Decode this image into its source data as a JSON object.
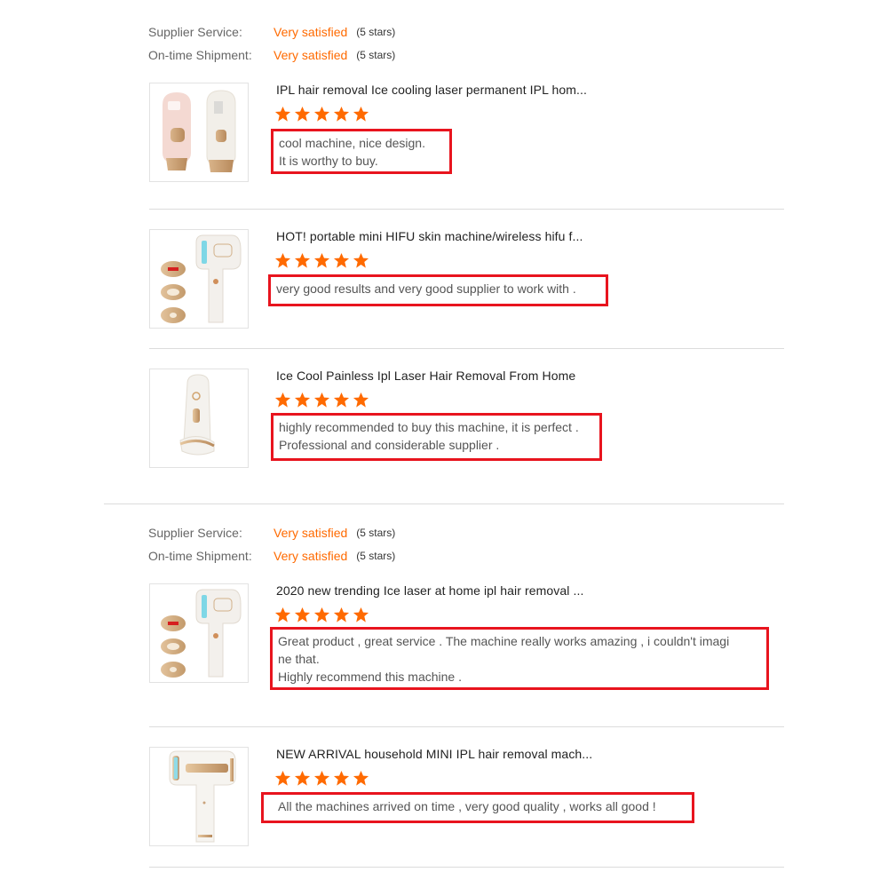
{
  "colors": {
    "accent": "#ff6a00",
    "highlight_border": "#e8141e",
    "star": "#ff6a00"
  },
  "groups": [
    {
      "supplier_service_label": "Supplier Service:",
      "supplier_service_value": "Very satisfied",
      "supplier_service_stars": "(5 stars)",
      "shipment_label": "On-time Shipment:",
      "shipment_value": "Very satisfied",
      "shipment_stars": "(5 stars)",
      "reviews": [
        {
          "product_title": "IPL hair removal Ice cooling laser permanent IPL hom...",
          "rating": 5,
          "image_icon": "pink-and-white-ipl-device",
          "comment_lines": [
            "cool machine, nice design.",
            "It is worthy to buy."
          ]
        },
        {
          "product_title": "HOT! portable mini HIFU skin machine/wireless hifu f...",
          "rating": 5,
          "image_icon": "hifu-device-with-cartridges",
          "comment_lines": [
            "very good results and very good supplier to work with ."
          ]
        },
        {
          "product_title": "Ice Cool Painless Ipl Laser Hair Removal From Home",
          "rating": 5,
          "image_icon": "white-handheld-ipl-device",
          "comment_lines": [
            "highly recommended to buy this machine, it is perfect .",
            "Professional and considerable supplier ."
          ]
        }
      ]
    },
    {
      "supplier_service_label": "Supplier Service:",
      "supplier_service_value": "Very satisfied",
      "supplier_service_stars": "(5 stars)",
      "shipment_label": "On-time Shipment:",
      "shipment_value": "Very satisfied",
      "shipment_stars": "(5 stars)",
      "reviews": [
        {
          "product_title": "2020 new trending Ice laser at home ipl hair removal ...",
          "rating": 5,
          "image_icon": "ipl-device-with-cartridges",
          "comment_lines": [
            "Great product , great service . The machine really works amazing , i couldn't imagi",
            "ne that.",
            "Highly recommend this machine ."
          ]
        },
        {
          "product_title": "NEW ARRIVAL household MINI IPL hair removal mach...",
          "rating": 5,
          "image_icon": "white-gold-mini-ipl-device",
          "comment_lines": [
            "All the machines arrived on time , very good quality , works all good !"
          ]
        }
      ]
    }
  ]
}
